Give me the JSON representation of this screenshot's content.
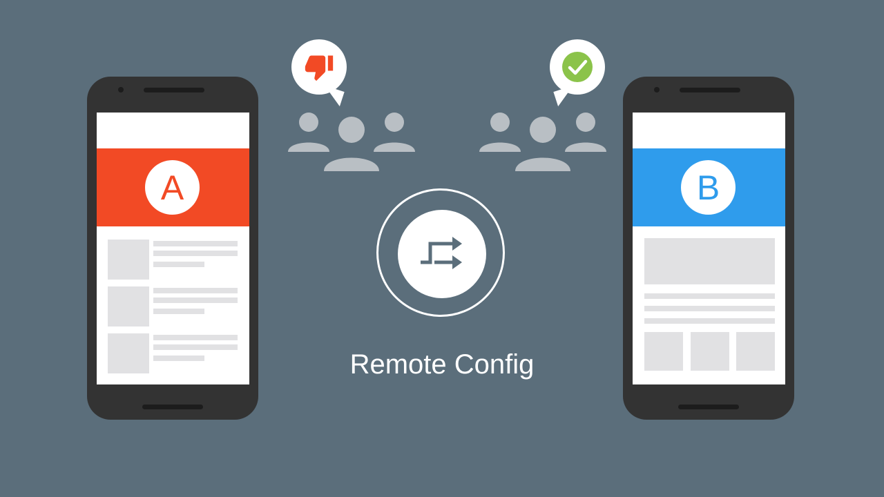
{
  "variant_a": {
    "letter": "A",
    "color": "#f24a25",
    "feedback_icon": "thumbs-down-icon"
  },
  "variant_b": {
    "letter": "B",
    "color": "#2f9cec",
    "feedback_icon": "checkmark-icon"
  },
  "center": {
    "icon": "switch-arrows-icon",
    "caption": "Remote Config"
  },
  "colors": {
    "background": "#5b6e7b",
    "phone": "#333333",
    "placeholder": "#e1e1e3",
    "people": "#b9bfc4",
    "check": "#8bc34a"
  }
}
